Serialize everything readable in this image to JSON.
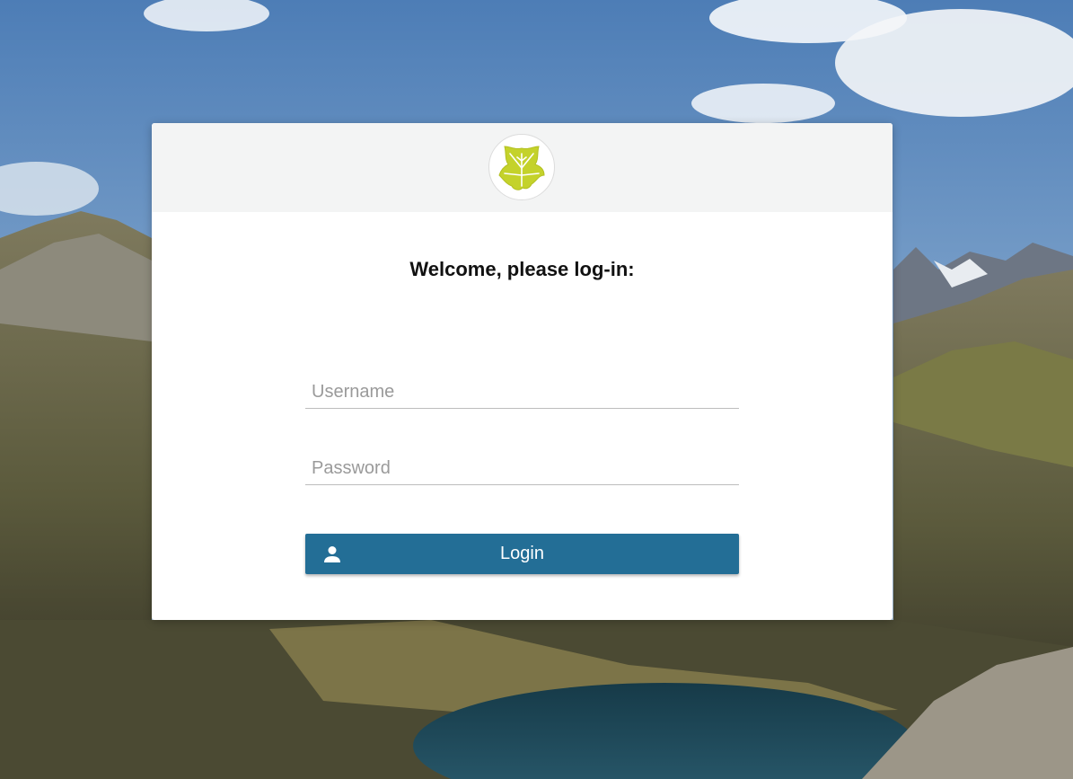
{
  "background": {
    "description_icon": "mountain-lake-icon",
    "colors": {
      "sky_top": "#4e7fb8",
      "sky_bottom": "#a9c3dc",
      "mountain": "#3d3b2c",
      "lake": "#1f4656"
    }
  },
  "login_card": {
    "logo_icon": "ivy-leaf-icon",
    "logo_colors": {
      "leaf": "#c4d22b",
      "vein": "#ffffff"
    },
    "title": "Welcome, please log-in:",
    "username": {
      "placeholder": "Username",
      "value": ""
    },
    "password": {
      "placeholder": "Password",
      "value": ""
    },
    "login_button": {
      "label": "Login",
      "icon": "user-icon",
      "color": "#236e96"
    }
  }
}
